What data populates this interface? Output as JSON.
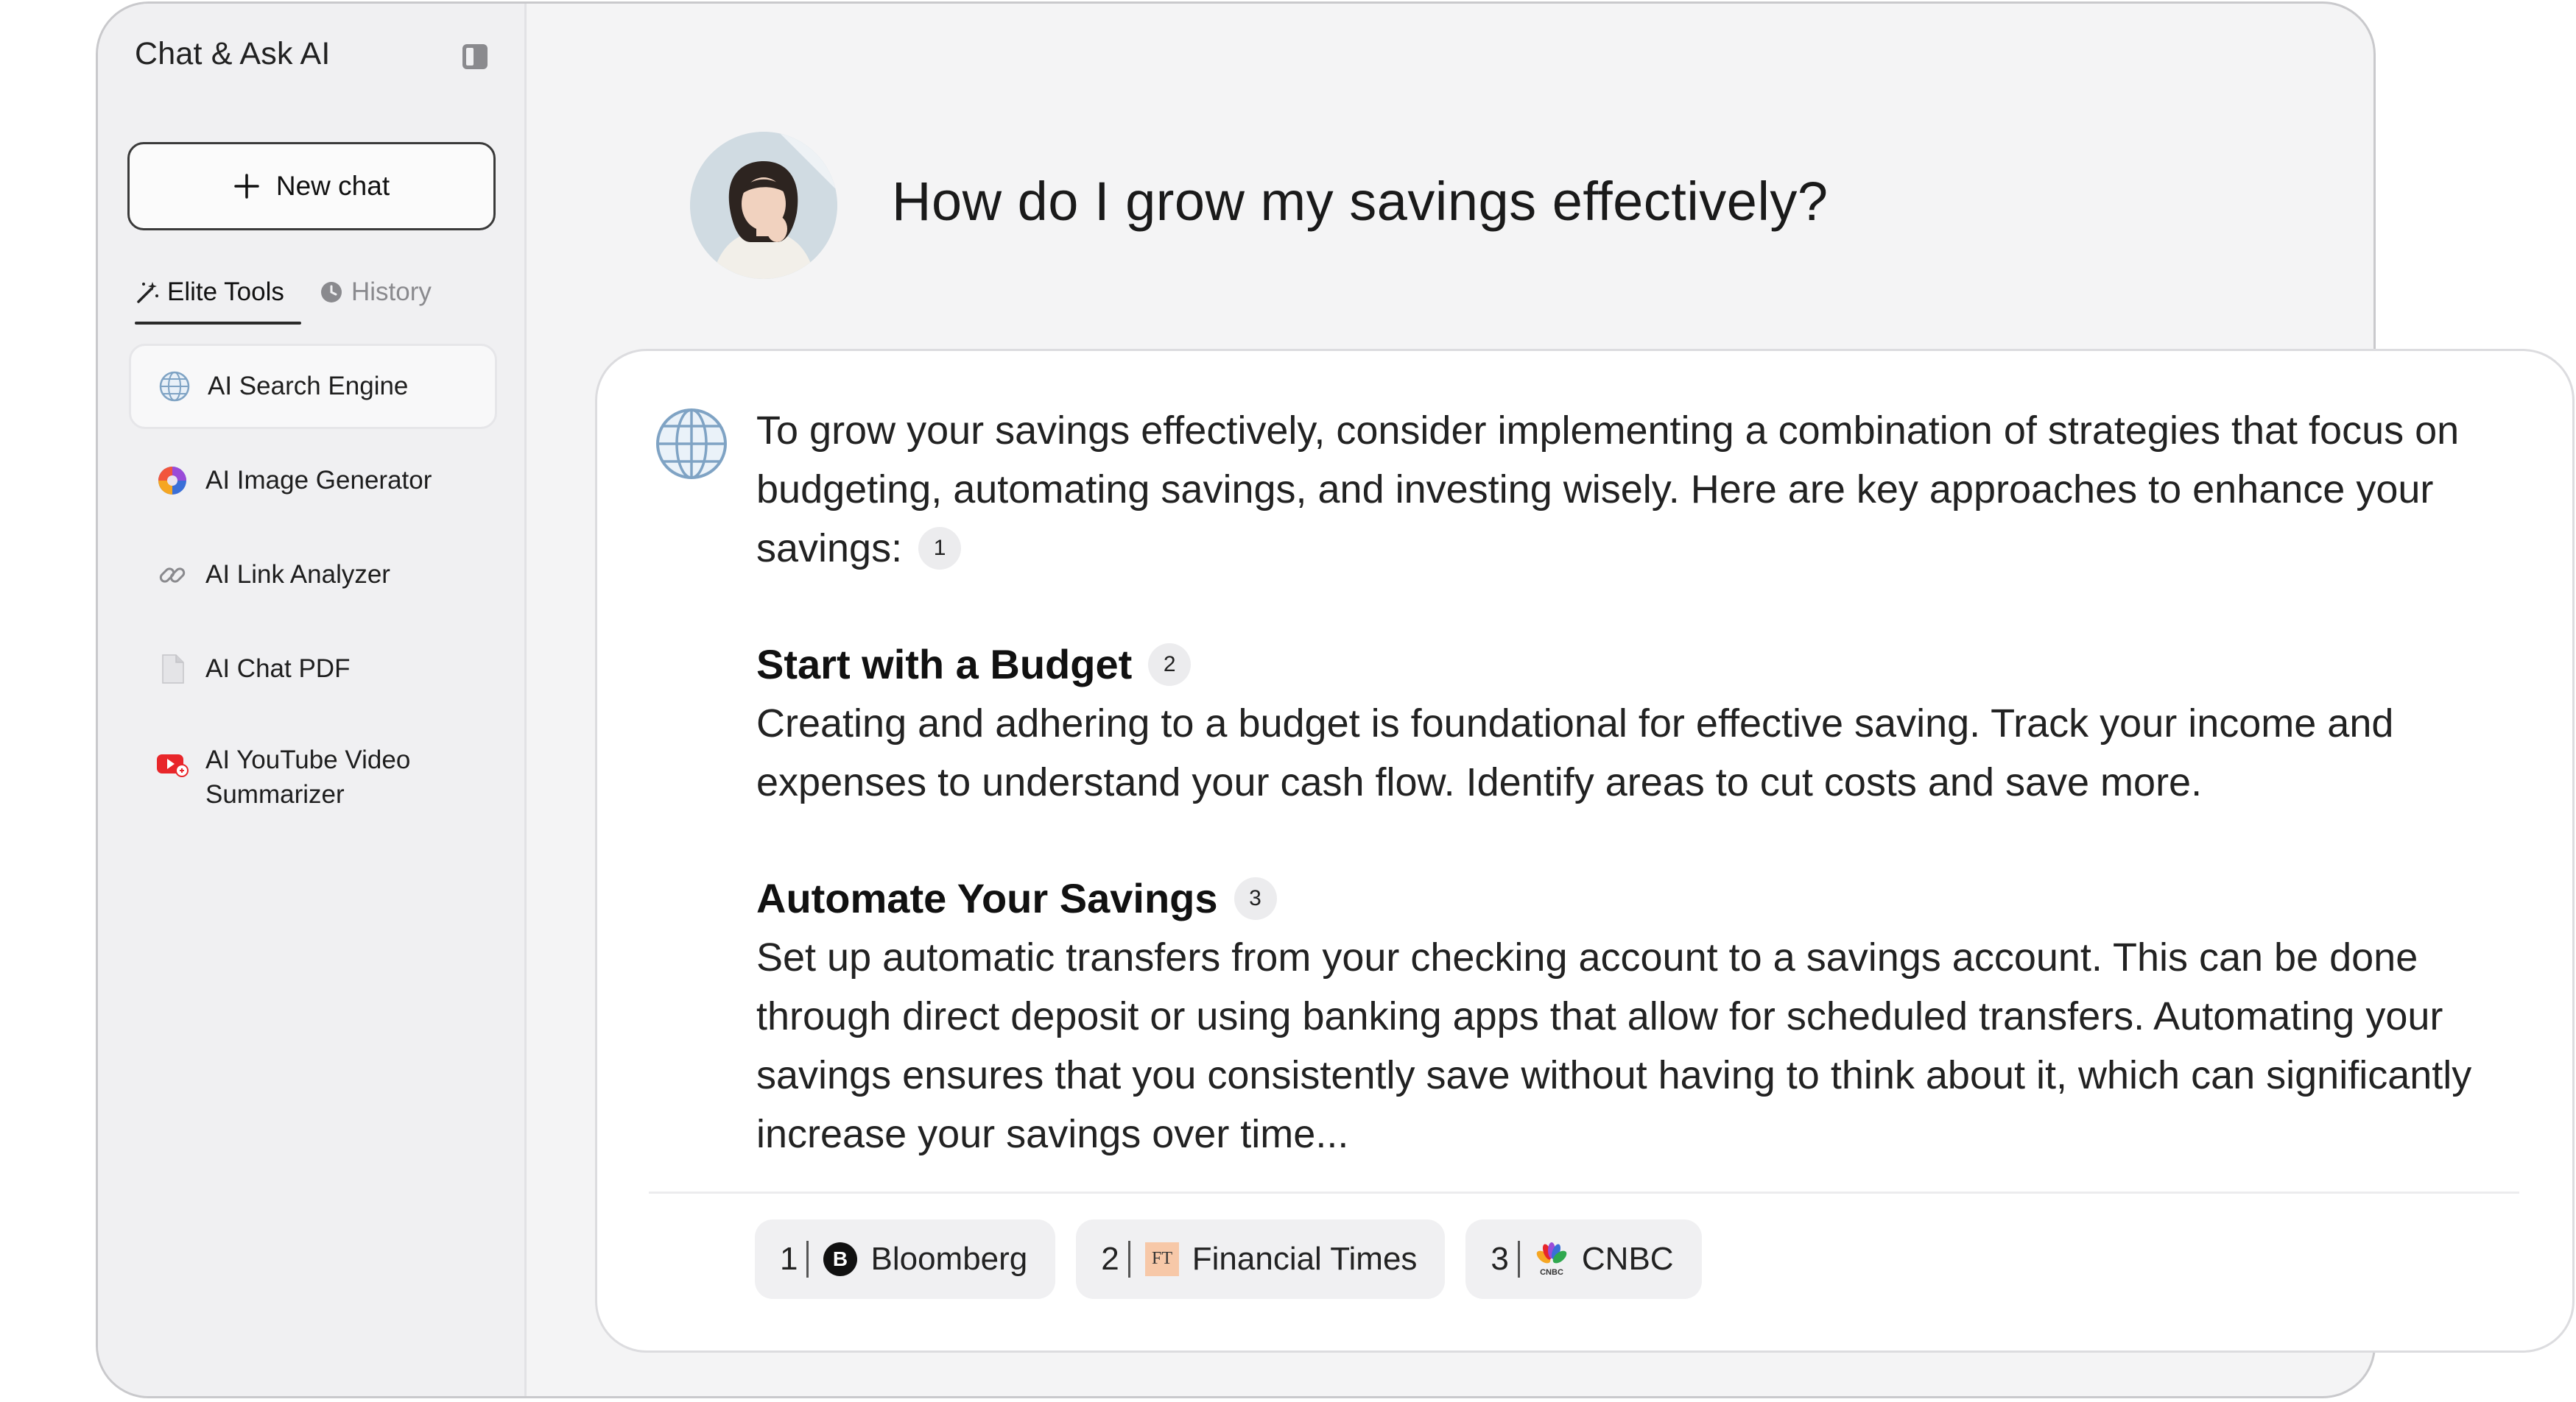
{
  "sidebar": {
    "app_title": "Chat & Ask AI",
    "new_chat_label": "New chat",
    "tabs": [
      {
        "label": "Elite Tools",
        "icon": "magic-wand-icon",
        "active": true
      },
      {
        "label": "History",
        "icon": "clock-icon",
        "active": false
      }
    ],
    "items": [
      {
        "label": "AI Search Engine",
        "icon": "globe-icon",
        "active": true
      },
      {
        "label": "AI Image Generator",
        "icon": "color-swirl-icon",
        "active": false
      },
      {
        "label": "AI Link Analyzer",
        "icon": "link-icon",
        "active": false
      },
      {
        "label": "AI Chat PDF",
        "icon": "document-icon",
        "active": false
      },
      {
        "label_line1": "AI YouTube Video",
        "label_line2": "Summarizer",
        "icon": "youtube-icon",
        "active": false
      }
    ]
  },
  "conversation": {
    "question": "How do I grow my savings effectively?",
    "answer": {
      "intro": "To grow your savings effectively, consider implementing a combination of strategies that focus on budgeting, automating savings, and investing wisely. Here are key approaches to enhance your savings:",
      "intro_cite": "1",
      "sections": [
        {
          "heading": "Start with a Budget",
          "cite": "2",
          "text": "Creating and adhering to a budget is foundational for effective saving. Track your income and expenses to understand your cash flow. Identify areas to cut costs and save more."
        },
        {
          "heading": "Automate Your Savings",
          "cite": "3",
          "text": "Set up automatic transfers from your checking account to a savings account. This can be done through direct deposit or using banking apps that allow for scheduled transfers. Automating your savings ensures that you consistently save without having to think about it, which can significantly increase your savings over time..."
        }
      ]
    },
    "sources": [
      {
        "num": "1",
        "name": "Bloomberg",
        "icon": "bloomberg-logo",
        "logo_text": "B"
      },
      {
        "num": "2",
        "name": "Financial Times",
        "icon": "financial-times-logo",
        "logo_text": "FT"
      },
      {
        "num": "3",
        "name": "CNBC",
        "icon": "cnbc-logo",
        "logo_text": "CNBC"
      }
    ]
  },
  "colors": {
    "window_bg": "#f4f4f5",
    "sidebar_bg": "#f0f0f2",
    "card_bg": "#ffffff",
    "chip_bg": "#f0f0f2",
    "ft_pink": "#f7c8a8"
  }
}
